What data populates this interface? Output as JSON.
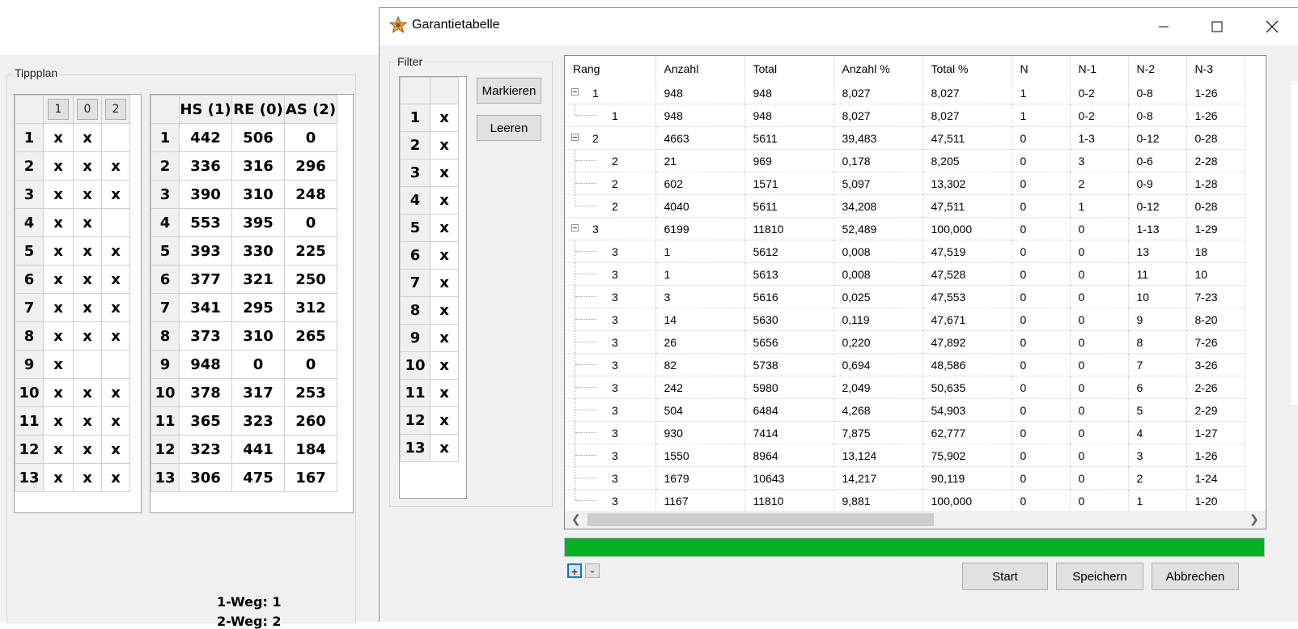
{
  "background": {
    "tippplan_label": "Tippplan",
    "headers": [
      "1",
      "0",
      "2"
    ],
    "rows": [
      {
        "n": "1",
        "c": [
          "x",
          "x",
          ""
        ]
      },
      {
        "n": "2",
        "c": [
          "x",
          "x",
          "x"
        ]
      },
      {
        "n": "3",
        "c": [
          "x",
          "x",
          "x"
        ]
      },
      {
        "n": "4",
        "c": [
          "x",
          "x",
          ""
        ]
      },
      {
        "n": "5",
        "c": [
          "x",
          "x",
          "x"
        ]
      },
      {
        "n": "6",
        "c": [
          "x",
          "x",
          "x"
        ]
      },
      {
        "n": "7",
        "c": [
          "x",
          "x",
          "x"
        ]
      },
      {
        "n": "8",
        "c": [
          "x",
          "x",
          "x"
        ]
      },
      {
        "n": "9",
        "c": [
          "x",
          "",
          ""
        ]
      },
      {
        "n": "10",
        "c": [
          "x",
          "x",
          "x"
        ]
      },
      {
        "n": "11",
        "c": [
          "x",
          "x",
          "x"
        ]
      },
      {
        "n": "12",
        "c": [
          "x",
          "x",
          "x"
        ]
      },
      {
        "n": "13",
        "c": [
          "x",
          "x",
          "x"
        ]
      }
    ],
    "stats_headers": [
      "HS (1)",
      "RE (0)",
      "AS (2)"
    ],
    "stats_rows": [
      {
        "n": "1",
        "c": [
          "442",
          "506",
          "0"
        ]
      },
      {
        "n": "2",
        "c": [
          "336",
          "316",
          "296"
        ]
      },
      {
        "n": "3",
        "c": [
          "390",
          "310",
          "248"
        ]
      },
      {
        "n": "4",
        "c": [
          "553",
          "395",
          "0"
        ]
      },
      {
        "n": "5",
        "c": [
          "393",
          "330",
          "225"
        ]
      },
      {
        "n": "6",
        "c": [
          "377",
          "321",
          "250"
        ]
      },
      {
        "n": "7",
        "c": [
          "341",
          "295",
          "312"
        ]
      },
      {
        "n": "8",
        "c": [
          "373",
          "310",
          "265"
        ]
      },
      {
        "n": "9",
        "c": [
          "948",
          "0",
          "0"
        ]
      },
      {
        "n": "10",
        "c": [
          "378",
          "317",
          "253"
        ]
      },
      {
        "n": "11",
        "c": [
          "365",
          "323",
          "260"
        ]
      },
      {
        "n": "12",
        "c": [
          "323",
          "441",
          "184"
        ]
      },
      {
        "n": "13",
        "c": [
          "306",
          "475",
          "167"
        ]
      }
    ],
    "weg1_label": "1-Weg:",
    "weg1_value": "1",
    "weg2_label": "2-Weg:",
    "weg2_value": "2"
  },
  "dialog": {
    "title": "Garantietabelle",
    "filter_label": "Filter",
    "filter_rows": [
      {
        "n": "1",
        "v": "x"
      },
      {
        "n": "2",
        "v": "x"
      },
      {
        "n": "3",
        "v": "x"
      },
      {
        "n": "4",
        "v": "x"
      },
      {
        "n": "5",
        "v": "x"
      },
      {
        "n": "6",
        "v": "x"
      },
      {
        "n": "7",
        "v": "x"
      },
      {
        "n": "8",
        "v": "x"
      },
      {
        "n": "9",
        "v": "x"
      },
      {
        "n": "10",
        "v": "x"
      },
      {
        "n": "11",
        "v": "x"
      },
      {
        "n": "12",
        "v": "x"
      },
      {
        "n": "13",
        "v": "x"
      }
    ],
    "markieren_label": "Markieren",
    "leeren_label": "Leeren",
    "columns": [
      "Rang",
      "Anzahl",
      "Total",
      "Anzahl %",
      "Total %",
      "N",
      "N-1",
      "N-2",
      "N-3"
    ],
    "rows": [
      {
        "level": 0,
        "last": false,
        "cells": [
          "1",
          "948",
          "948",
          "8,027",
          "8,027",
          "1",
          "0-2",
          "0-8",
          "1-26"
        ]
      },
      {
        "level": 1,
        "last": true,
        "cells": [
          "1",
          "948",
          "948",
          "8,027",
          "8,027",
          "1",
          "0-2",
          "0-8",
          "1-26"
        ]
      },
      {
        "level": 0,
        "last": false,
        "cells": [
          "2",
          "4663",
          "5611",
          "39,483",
          "47,511",
          "0",
          "1-3",
          "0-12",
          "0-28"
        ]
      },
      {
        "level": 1,
        "last": false,
        "cells": [
          "2",
          "21",
          "969",
          "0,178",
          "8,205",
          "0",
          "3",
          "0-6",
          "2-28"
        ]
      },
      {
        "level": 1,
        "last": false,
        "cells": [
          "2",
          "602",
          "1571",
          "5,097",
          "13,302",
          "0",
          "2",
          "0-9",
          "1-28"
        ]
      },
      {
        "level": 1,
        "last": true,
        "cells": [
          "2",
          "4040",
          "5611",
          "34,208",
          "47,511",
          "0",
          "1",
          "0-12",
          "0-28"
        ]
      },
      {
        "level": 0,
        "last": false,
        "cells": [
          "3",
          "6199",
          "11810",
          "52,489",
          "100,000",
          "0",
          "0",
          "1-13",
          "1-29"
        ]
      },
      {
        "level": 1,
        "last": false,
        "cells": [
          "3",
          "1",
          "5612",
          "0,008",
          "47,519",
          "0",
          "0",
          "13",
          "18"
        ]
      },
      {
        "level": 1,
        "last": false,
        "cells": [
          "3",
          "1",
          "5613",
          "0,008",
          "47,528",
          "0",
          "0",
          "11",
          "10"
        ]
      },
      {
        "level": 1,
        "last": false,
        "cells": [
          "3",
          "3",
          "5616",
          "0,025",
          "47,553",
          "0",
          "0",
          "10",
          "7-23"
        ]
      },
      {
        "level": 1,
        "last": false,
        "cells": [
          "3",
          "14",
          "5630",
          "0,119",
          "47,671",
          "0",
          "0",
          "9",
          "8-20"
        ]
      },
      {
        "level": 1,
        "last": false,
        "cells": [
          "3",
          "26",
          "5656",
          "0,220",
          "47,892",
          "0",
          "0",
          "8",
          "7-26"
        ]
      },
      {
        "level": 1,
        "last": false,
        "cells": [
          "3",
          "82",
          "5738",
          "0,694",
          "48,586",
          "0",
          "0",
          "7",
          "3-26"
        ]
      },
      {
        "level": 1,
        "last": false,
        "cells": [
          "3",
          "242",
          "5980",
          "2,049",
          "50,635",
          "0",
          "0",
          "6",
          "2-26"
        ]
      },
      {
        "level": 1,
        "last": false,
        "cells": [
          "3",
          "504",
          "6484",
          "4,268",
          "54,903",
          "0",
          "0",
          "5",
          "2-29"
        ]
      },
      {
        "level": 1,
        "last": false,
        "cells": [
          "3",
          "930",
          "7414",
          "7,875",
          "62,777",
          "0",
          "0",
          "4",
          "1-27"
        ]
      },
      {
        "level": 1,
        "last": false,
        "cells": [
          "3",
          "1550",
          "8964",
          "13,124",
          "75,902",
          "0",
          "0",
          "3",
          "1-26"
        ]
      },
      {
        "level": 1,
        "last": false,
        "cells": [
          "3",
          "1679",
          "10643",
          "14,217",
          "90,119",
          "0",
          "0",
          "2",
          "1-24"
        ]
      },
      {
        "level": 1,
        "last": true,
        "cells": [
          "3",
          "1167",
          "11810",
          "9,881",
          "100,000",
          "0",
          "0",
          "1",
          "1-20"
        ]
      }
    ],
    "progress": 1.0,
    "expand_label": "+",
    "collapse_label": "-",
    "start_label": "Start",
    "speichern_label": "Speichern",
    "abbrechen_label": "Abbrechen"
  },
  "colors": {
    "progress": "#06b025",
    "title_bg": "#ffffff",
    "window_bg": "#f0f0f0"
  },
  "icons": [
    "app-star-icon",
    "minimize-icon",
    "maximize-icon",
    "close-icon",
    "tree-collapse-icon",
    "scroll-left-icon",
    "scroll-right-icon"
  ]
}
